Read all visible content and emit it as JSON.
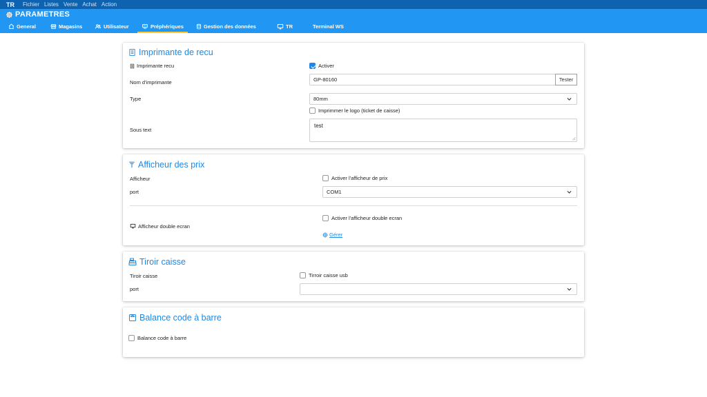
{
  "menubar": {
    "brand": "TR",
    "items": [
      "Fichier",
      "Listes",
      "Vente",
      "Achat",
      "Action"
    ]
  },
  "header": {
    "title": "PARAMETRES",
    "tabs": [
      "General",
      "Magasins",
      "Utilisateur",
      "Préphériques",
      "Gestion des données",
      "TR",
      "Terminal WS"
    ],
    "active_tab": "Préphériques"
  },
  "imprimante": {
    "title": "Imprimante de recu",
    "label_imprimante": "Imprimante recu",
    "activer_label": "Activer",
    "activer_checked": true,
    "label_nom": "Nom d'imprimante",
    "nom_value": "GP-80160",
    "tester_label": "Tester",
    "label_type": "Type",
    "type_value": "80mm",
    "logo_label": "Imprimmer le logo (ticket de caisse)",
    "logo_checked": false,
    "label_sous_text": "Sous text",
    "sous_text_value": "test"
  },
  "afficheur": {
    "title": "Afficheur des prix",
    "label_afficheur": "Afficheur",
    "activer_prix_label": "Activer l'afficheur de prix",
    "label_port": "port",
    "port_value": "COM1",
    "label_double": "Afficheur double ecran",
    "activer_double_label": "Activer l'afficheur double ecran",
    "gerer_label": "Gérer"
  },
  "tiroir": {
    "title": "Tiroir caisse",
    "label_tiroir": "Tiroir caisse",
    "usb_label": "Tirroir caisse usb",
    "label_port": "port",
    "port_value": ""
  },
  "balance": {
    "title": "Balance code à barre",
    "checkbox_label": "Balance code à barre"
  },
  "colors": {
    "menubar": "#0d63b0",
    "header": "#2196f3",
    "accent": "#1e88e5",
    "active_tab_underline": "#ffcc33"
  }
}
